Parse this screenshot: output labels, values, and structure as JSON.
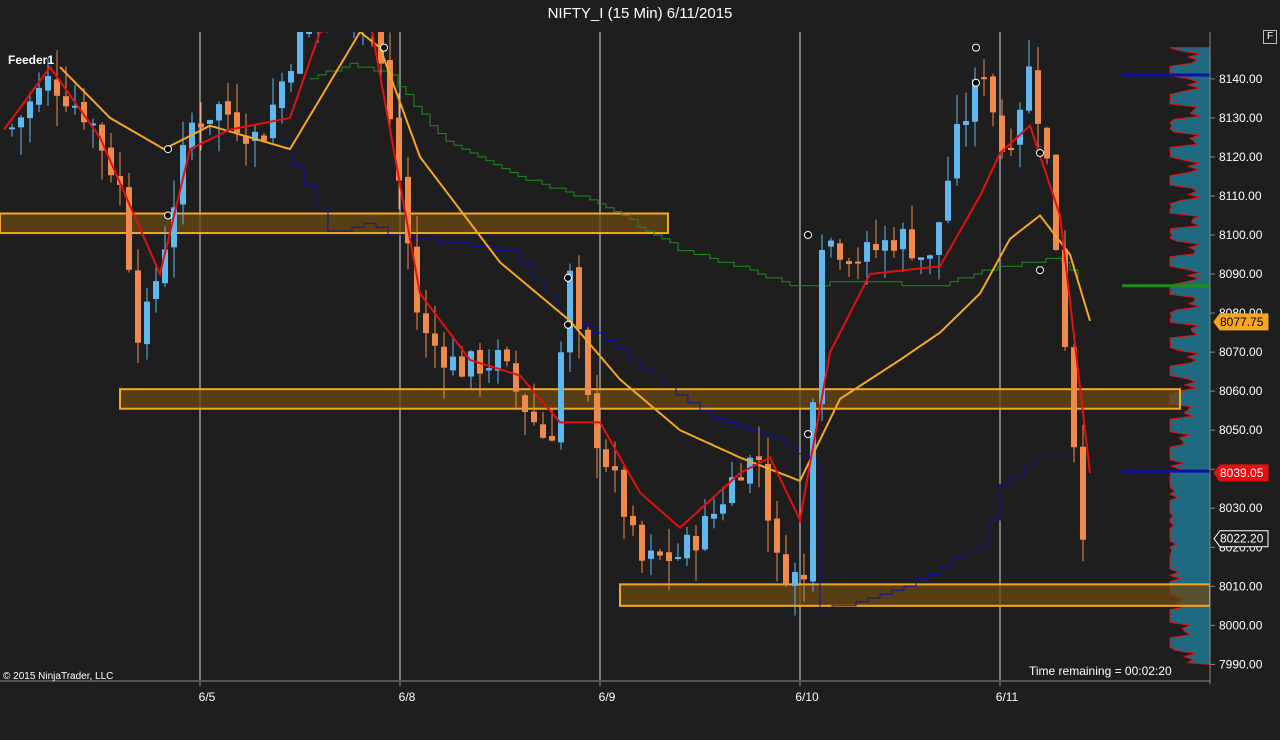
{
  "title": "NIFTY_I (15 Min)  6/11/2015",
  "feeder_label": "Feeder1",
  "copyright": "© 2015 NinjaTrader, LLC",
  "time_remaining": "Time remaining = 00:02:20",
  "panel_button": "F",
  "colors": {
    "background": "#1e1e1e",
    "up_candle": "#5fb8f0",
    "down_candle": "#f08a4b",
    "fast_ma": "#e41010",
    "slow_ma": "#f5a623",
    "green_line": "#1e8c1e",
    "blue_line": "#1010a0",
    "zone_fill": "#6b4a12",
    "zone_border": "#f5a623",
    "profile": "#1e6a80",
    "profile_edge": "#e41010"
  },
  "chart_data": {
    "type": "candlestick",
    "title": "NIFTY_I (15 Min)  6/11/2015",
    "x_tick_labels": [
      "6/5",
      "6/8",
      "6/9",
      "6/10",
      "6/11"
    ],
    "y_tick_labels": [
      "8140.00",
      "8130.00",
      "8120.00",
      "8110.00",
      "8100.00",
      "8090.00",
      "8080.00",
      "8070.00",
      "8060.00",
      "8050.00",
      "8040.00",
      "8030.00",
      "8020.00",
      "8010.00",
      "8000.00",
      "7990.00"
    ],
    "ylim": [
      7986,
      8152
    ],
    "price_markers": [
      {
        "label": "8077.75",
        "value": 8077.75,
        "color": "#f5a623"
      },
      {
        "label": "8039.05",
        "value": 8039.05,
        "color": "#e41010"
      },
      {
        "label": "8022.20",
        "value": 8022.2,
        "color": "#ffffff"
      }
    ],
    "zones": [
      {
        "from_day": 0.0,
        "to_day": 3.34,
        "low": 8100.5,
        "high": 8105.5
      },
      {
        "from_day": 0.6,
        "to_day": 5.9,
        "low": 8055.5,
        "high": 8060.5
      },
      {
        "from_day": 3.1,
        "to_day": 6.05,
        "low": 8005,
        "high": 8010.5
      }
    ],
    "session_separators": [
      1,
      2,
      3,
      4,
      5
    ],
    "profile_levels": [
      {
        "price": 8141,
        "color": "#1010a0"
      },
      {
        "price": 8087,
        "color": "#1e8c1e"
      },
      {
        "price": 8039.5,
        "color": "#1010a0"
      }
    ],
    "series": [
      {
        "name": "",
        "kind": "candles",
        "anchors": [
          [
            0.05,
            8127
          ],
          [
            0.25,
            8140
          ],
          [
            0.45,
            8130
          ],
          [
            0.6,
            8112
          ],
          [
            0.7,
            8072
          ],
          [
            0.82,
            8097
          ],
          [
            0.95,
            8128
          ],
          [
            1.1,
            8133
          ],
          [
            1.3,
            8124
          ],
          [
            1.45,
            8145
          ],
          [
            1.6,
            8160
          ],
          [
            1.85,
            8158
          ],
          [
            1.95,
            8130
          ],
          [
            2.02,
            8105
          ],
          [
            2.1,
            8075
          ],
          [
            2.3,
            8066
          ],
          [
            2.5,
            8068
          ],
          [
            2.6,
            8058
          ],
          [
            2.75,
            8046
          ],
          [
            2.85,
            8089
          ],
          [
            2.95,
            8053
          ],
          [
            3.1,
            8033
          ],
          [
            3.2,
            8016
          ],
          [
            3.4,
            8018
          ],
          [
            3.55,
            8027
          ],
          [
            3.7,
            8041
          ],
          [
            3.8,
            8043
          ],
          [
            3.88,
            8016
          ],
          [
            4.02,
            8011
          ],
          [
            4.1,
            8100
          ],
          [
            4.3,
            8094
          ],
          [
            4.5,
            8100
          ],
          [
            4.65,
            8093
          ],
          [
            4.78,
            8124
          ],
          [
            4.92,
            8143
          ],
          [
            5.02,
            8120
          ],
          [
            5.15,
            8143
          ],
          [
            5.25,
            8114
          ],
          [
            5.35,
            8060
          ],
          [
            5.4,
            8029
          ],
          [
            5.45,
            8018
          ]
        ]
      },
      {
        "name": "",
        "kind": "fast-ma",
        "anchors": [
          [
            0.02,
            8127
          ],
          [
            0.25,
            8143
          ],
          [
            0.5,
            8125
          ],
          [
            0.8,
            8090
          ],
          [
            0.95,
            8122
          ],
          [
            1.15,
            8127
          ],
          [
            1.45,
            8130
          ],
          [
            1.6,
            8152
          ],
          [
            1.85,
            8155
          ],
          [
            2.1,
            8085
          ],
          [
            2.35,
            8068
          ],
          [
            2.6,
            8064
          ],
          [
            2.8,
            8052
          ],
          [
            3.0,
            8052
          ],
          [
            3.2,
            8034
          ],
          [
            3.4,
            8025
          ],
          [
            3.7,
            8039
          ],
          [
            3.85,
            8043
          ],
          [
            4.0,
            8027
          ],
          [
            4.15,
            8070
          ],
          [
            4.35,
            8090
          ],
          [
            4.7,
            8092
          ],
          [
            4.9,
            8110
          ],
          [
            5.0,
            8121
          ],
          [
            5.15,
            8128
          ],
          [
            5.3,
            8105
          ],
          [
            5.45,
            8039
          ]
        ]
      },
      {
        "name": "",
        "kind": "slow-ma",
        "anchors": [
          [
            0.3,
            8143
          ],
          [
            0.55,
            8130
          ],
          [
            0.82,
            8122
          ],
          [
            1.05,
            8128
          ],
          [
            1.45,
            8122
          ],
          [
            1.8,
            8152
          ],
          [
            1.9,
            8148
          ],
          [
            2.1,
            8120
          ],
          [
            2.5,
            8093
          ],
          [
            2.85,
            8078
          ],
          [
            3.1,
            8063
          ],
          [
            3.4,
            8050
          ],
          [
            3.7,
            8043
          ],
          [
            4.0,
            8037
          ],
          [
            4.2,
            8058
          ],
          [
            4.5,
            8068
          ],
          [
            4.7,
            8075
          ],
          [
            4.9,
            8085
          ],
          [
            5.05,
            8099
          ],
          [
            5.2,
            8105
          ],
          [
            5.35,
            8095
          ],
          [
            5.45,
            8078
          ]
        ]
      },
      {
        "name": "",
        "kind": "green-step",
        "anchors": [
          [
            1.55,
            8140
          ],
          [
            1.75,
            8144
          ],
          [
            1.95,
            8141
          ],
          [
            2.2,
            8125
          ],
          [
            2.6,
            8115
          ],
          [
            3.0,
            8108
          ],
          [
            3.4,
            8096
          ],
          [
            3.7,
            8092
          ],
          [
            3.95,
            8087
          ],
          [
            4.3,
            8088
          ],
          [
            4.7,
            8087
          ],
          [
            5.0,
            8092
          ],
          [
            5.3,
            8094
          ],
          [
            5.4,
            8087
          ]
        ]
      },
      {
        "name": "",
        "kind": "blue-step",
        "anchors": [
          [
            1.4,
            8124
          ],
          [
            1.55,
            8110
          ],
          [
            1.65,
            8100
          ],
          [
            1.85,
            8103
          ],
          [
            1.95,
            8100
          ],
          [
            2.55,
            8096
          ],
          [
            2.8,
            8080
          ],
          [
            3.0,
            8074
          ],
          [
            3.3,
            8062
          ],
          [
            3.6,
            8052
          ],
          [
            3.9,
            8047
          ],
          [
            4.05,
            8042
          ],
          [
            3.9,
            8002
          ],
          [
            4.3,
            8006
          ],
          [
            4.6,
            8012
          ],
          [
            4.9,
            8021
          ],
          [
            5.0,
            8036
          ],
          [
            5.2,
            8044
          ],
          [
            5.3,
            8043
          ]
        ]
      }
    ]
  }
}
